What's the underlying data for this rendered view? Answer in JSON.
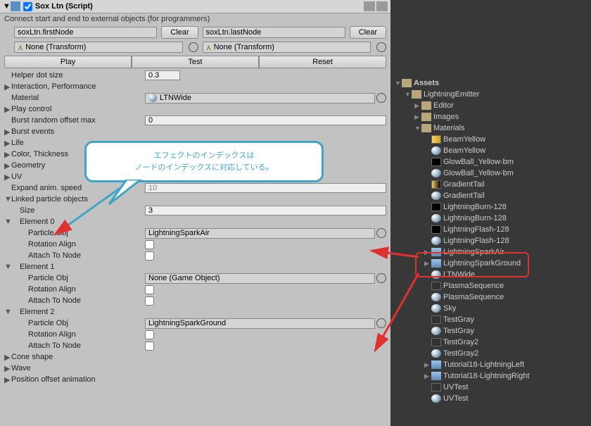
{
  "header": {
    "script_title": "Sox Ltn (Script)",
    "subtitle": "Connect start and end to external objects (for programmers)",
    "first_node": "soxLtn.firstNode",
    "last_node": "soxLtn.lastNode",
    "clear": "Clear",
    "none_transform": "None (Transform)",
    "play": "Play",
    "test": "Test",
    "reset": "Reset"
  },
  "props": {
    "helper_dot": {
      "label": "Helper dot size",
      "value": "0.3"
    },
    "interaction": {
      "label": "Interaction, Performance"
    },
    "material": {
      "label": "Material",
      "value": "LTNWide"
    },
    "play_control": {
      "label": "Play control"
    },
    "burst_offset": {
      "label": "Burst random offset max",
      "value": "0"
    },
    "burst_events": {
      "label": "Burst events"
    },
    "life": {
      "label": "Life"
    },
    "color": {
      "label": "Color, Thickness"
    },
    "geometry": {
      "label": "Geometry"
    },
    "uv": {
      "label": "UV"
    },
    "expand_anim": {
      "label": "Expand anim. speed",
      "value": "10"
    },
    "linked": {
      "label": "Linked particle objects"
    },
    "size": {
      "label": "Size",
      "value": "3"
    },
    "el0": {
      "label": "Element 0"
    },
    "el1": {
      "label": "Element 1"
    },
    "el2": {
      "label": "Element 2"
    },
    "particle_obj": "Particle Obj",
    "rotation_align": "Rotation Align",
    "attach_node": "Attach To Node",
    "spark_air": "LightningSparkAir",
    "none_go": "None (Game Object)",
    "spark_ground": "LightningSparkGround",
    "cone": {
      "label": "Cone shape"
    },
    "wave": {
      "label": "Wave"
    },
    "pos_anim": {
      "label": "Position offset animation"
    }
  },
  "tree": {
    "assets": "Assets",
    "emitter": "LightningEmitter",
    "editor": "Editor",
    "images": "Images",
    "materials": "Materials",
    "items": [
      "BeamYellow",
      "BeamYellow",
      "GlowBall_Yellow-bm",
      "GlowBall_Yellow-bm",
      "GradientTail",
      "GradientTail",
      "LightningBurn-128",
      "LightningBurn-128",
      "LightningFlash-128",
      "LightningFlash-128",
      "LightningSparkAir",
      "LightningSparkGround",
      "LTNWide",
      "PlasmaSequence",
      "PlasmaSequence",
      "Sky",
      "TestGray",
      "TestGray",
      "TestGray2",
      "TestGray2",
      "Tutorial18-LightningLeft",
      "Tutorial18-LightningRight",
      "UVTest",
      "UVTest"
    ]
  },
  "callout": {
    "line1": "エフェクトのインデックスは",
    "line2": "ノードのインデックスに対応している。"
  }
}
